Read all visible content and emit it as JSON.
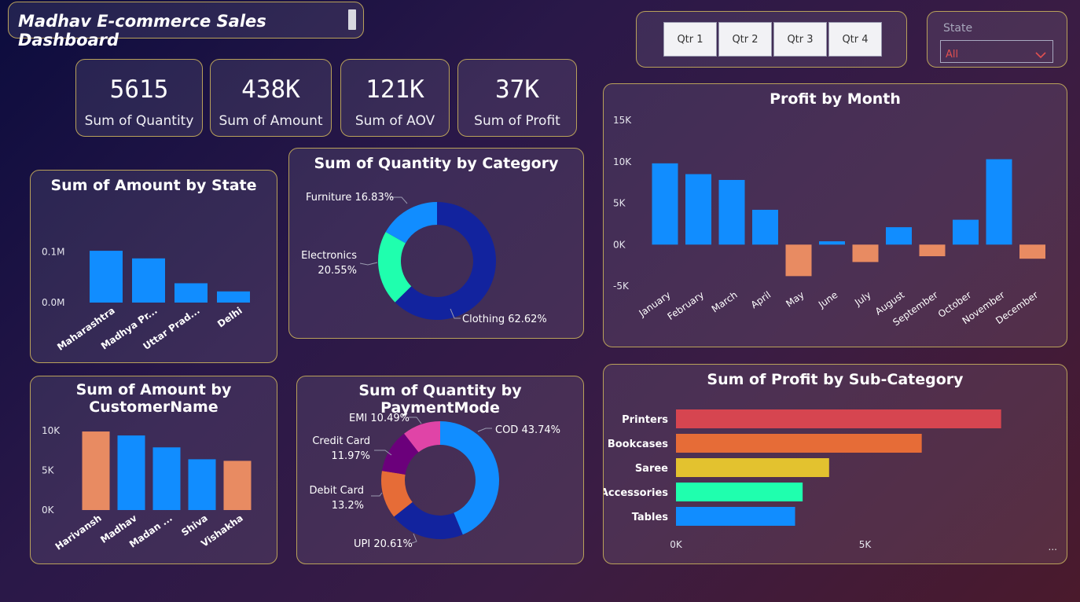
{
  "header": {
    "title": "Madhav E-commerce Sales Dashboard"
  },
  "kpis": [
    {
      "value": "5615",
      "label": "Sum of Quantity"
    },
    {
      "value": "438K",
      "label": "Sum of Amount"
    },
    {
      "value": "121K",
      "label": "Sum of AOV"
    },
    {
      "value": "37K",
      "label": "Sum of Profit"
    }
  ],
  "quarter_slicer": {
    "options": [
      "Qtr 1",
      "Qtr 2",
      "Qtr 3",
      "Qtr 4"
    ]
  },
  "state_filter": {
    "label": "State",
    "value": "All"
  },
  "colors": {
    "blue": "#118dff",
    "orange": "#e88b62",
    "navy": "#12239e",
    "teal": "#1fffae",
    "red": "#d64550",
    "dark_orange": "#e66c37",
    "yellow": "#e3c22f",
    "purple": "#744ec2",
    "pink": "#e044a7",
    "dark_purple": "#6b007b"
  },
  "chart_data": [
    {
      "id": "state",
      "type": "bar",
      "title": "Sum of Amount by State",
      "categories": [
        "Maharashtra",
        "Madhya Pr...",
        "Uttar Prad...",
        "Delhi"
      ],
      "values": [
        102000,
        87000,
        38000,
        22000
      ],
      "ylim": [
        0,
        130000
      ],
      "yticks": [
        {
          "v": 0,
          "label": "0.0M"
        },
        {
          "v": 100000,
          "label": "0.1M"
        }
      ]
    },
    {
      "id": "customer",
      "type": "bar",
      "title_lines": [
        "Sum of Amount by",
        "CustomerName"
      ],
      "categories": [
        "Harivansh",
        "Madhav",
        "Madan ...",
        "Shiva",
        "Vishakha"
      ],
      "values": [
        9900,
        9400,
        7900,
        6400,
        6200
      ],
      "highlight": [
        true,
        false,
        false,
        false,
        true
      ],
      "ylim": [
        0,
        10400
      ],
      "yticks": [
        {
          "v": 0,
          "label": "0K"
        },
        {
          "v": 5000,
          "label": "5K"
        },
        {
          "v": 10000,
          "label": "10K"
        }
      ]
    },
    {
      "id": "category",
      "type": "pie",
      "title": "Sum of Quantity by Category",
      "slices": [
        {
          "label": "Clothing 62.62%",
          "value": 62.62
        },
        {
          "label": "Electronics",
          "label2": "20.55%",
          "value": 20.55
        },
        {
          "label": "Furniture 16.83%",
          "value": 16.83
        }
      ]
    },
    {
      "id": "payment",
      "type": "pie",
      "title": "Sum of Quantity by PaymentMode",
      "slices": [
        {
          "label": "COD 43.74%",
          "value": 43.74
        },
        {
          "label": "UPI 20.61%",
          "value": 20.61
        },
        {
          "label": "Debit Card",
          "label2": "13.2%",
          "value": 13.2
        },
        {
          "label": "Credit Card",
          "label2": "11.97%",
          "value": 11.97
        },
        {
          "label": "EMI 10.49%",
          "value": 10.49
        }
      ]
    },
    {
      "id": "month",
      "type": "bar",
      "title": "Profit by Month",
      "categories": [
        "January",
        "February",
        "March",
        "April",
        "May",
        "June",
        "July",
        "August",
        "September",
        "October",
        "November",
        "December"
      ],
      "values": [
        9800,
        8500,
        7800,
        4200,
        -3800,
        400,
        -2100,
        2100,
        -1400,
        3000,
        10300,
        -1700
      ],
      "ylim": [
        -5000,
        15000
      ],
      "yticks": [
        {
          "v": -5000,
          "label": "-5K"
        },
        {
          "v": 0,
          "label": "0K"
        },
        {
          "v": 5000,
          "label": "5K"
        },
        {
          "v": 10000,
          "label": "10K"
        },
        {
          "v": 15000,
          "label": "15K"
        }
      ]
    },
    {
      "id": "subcat",
      "type": "bar",
      "orientation": "horizontal",
      "title": "Sum of Profit by Sub-Category",
      "categories": [
        "Printers",
        "Bookcases",
        "Saree",
        "Accessories",
        "Tables"
      ],
      "values": [
        8600,
        6500,
        4050,
        3350,
        3150
      ],
      "xlim": [
        0,
        10000
      ],
      "xticks": [
        {
          "v": 0,
          "label": "0K"
        },
        {
          "v": 5000,
          "label": "5K"
        }
      ],
      "more_label": "..."
    }
  ]
}
